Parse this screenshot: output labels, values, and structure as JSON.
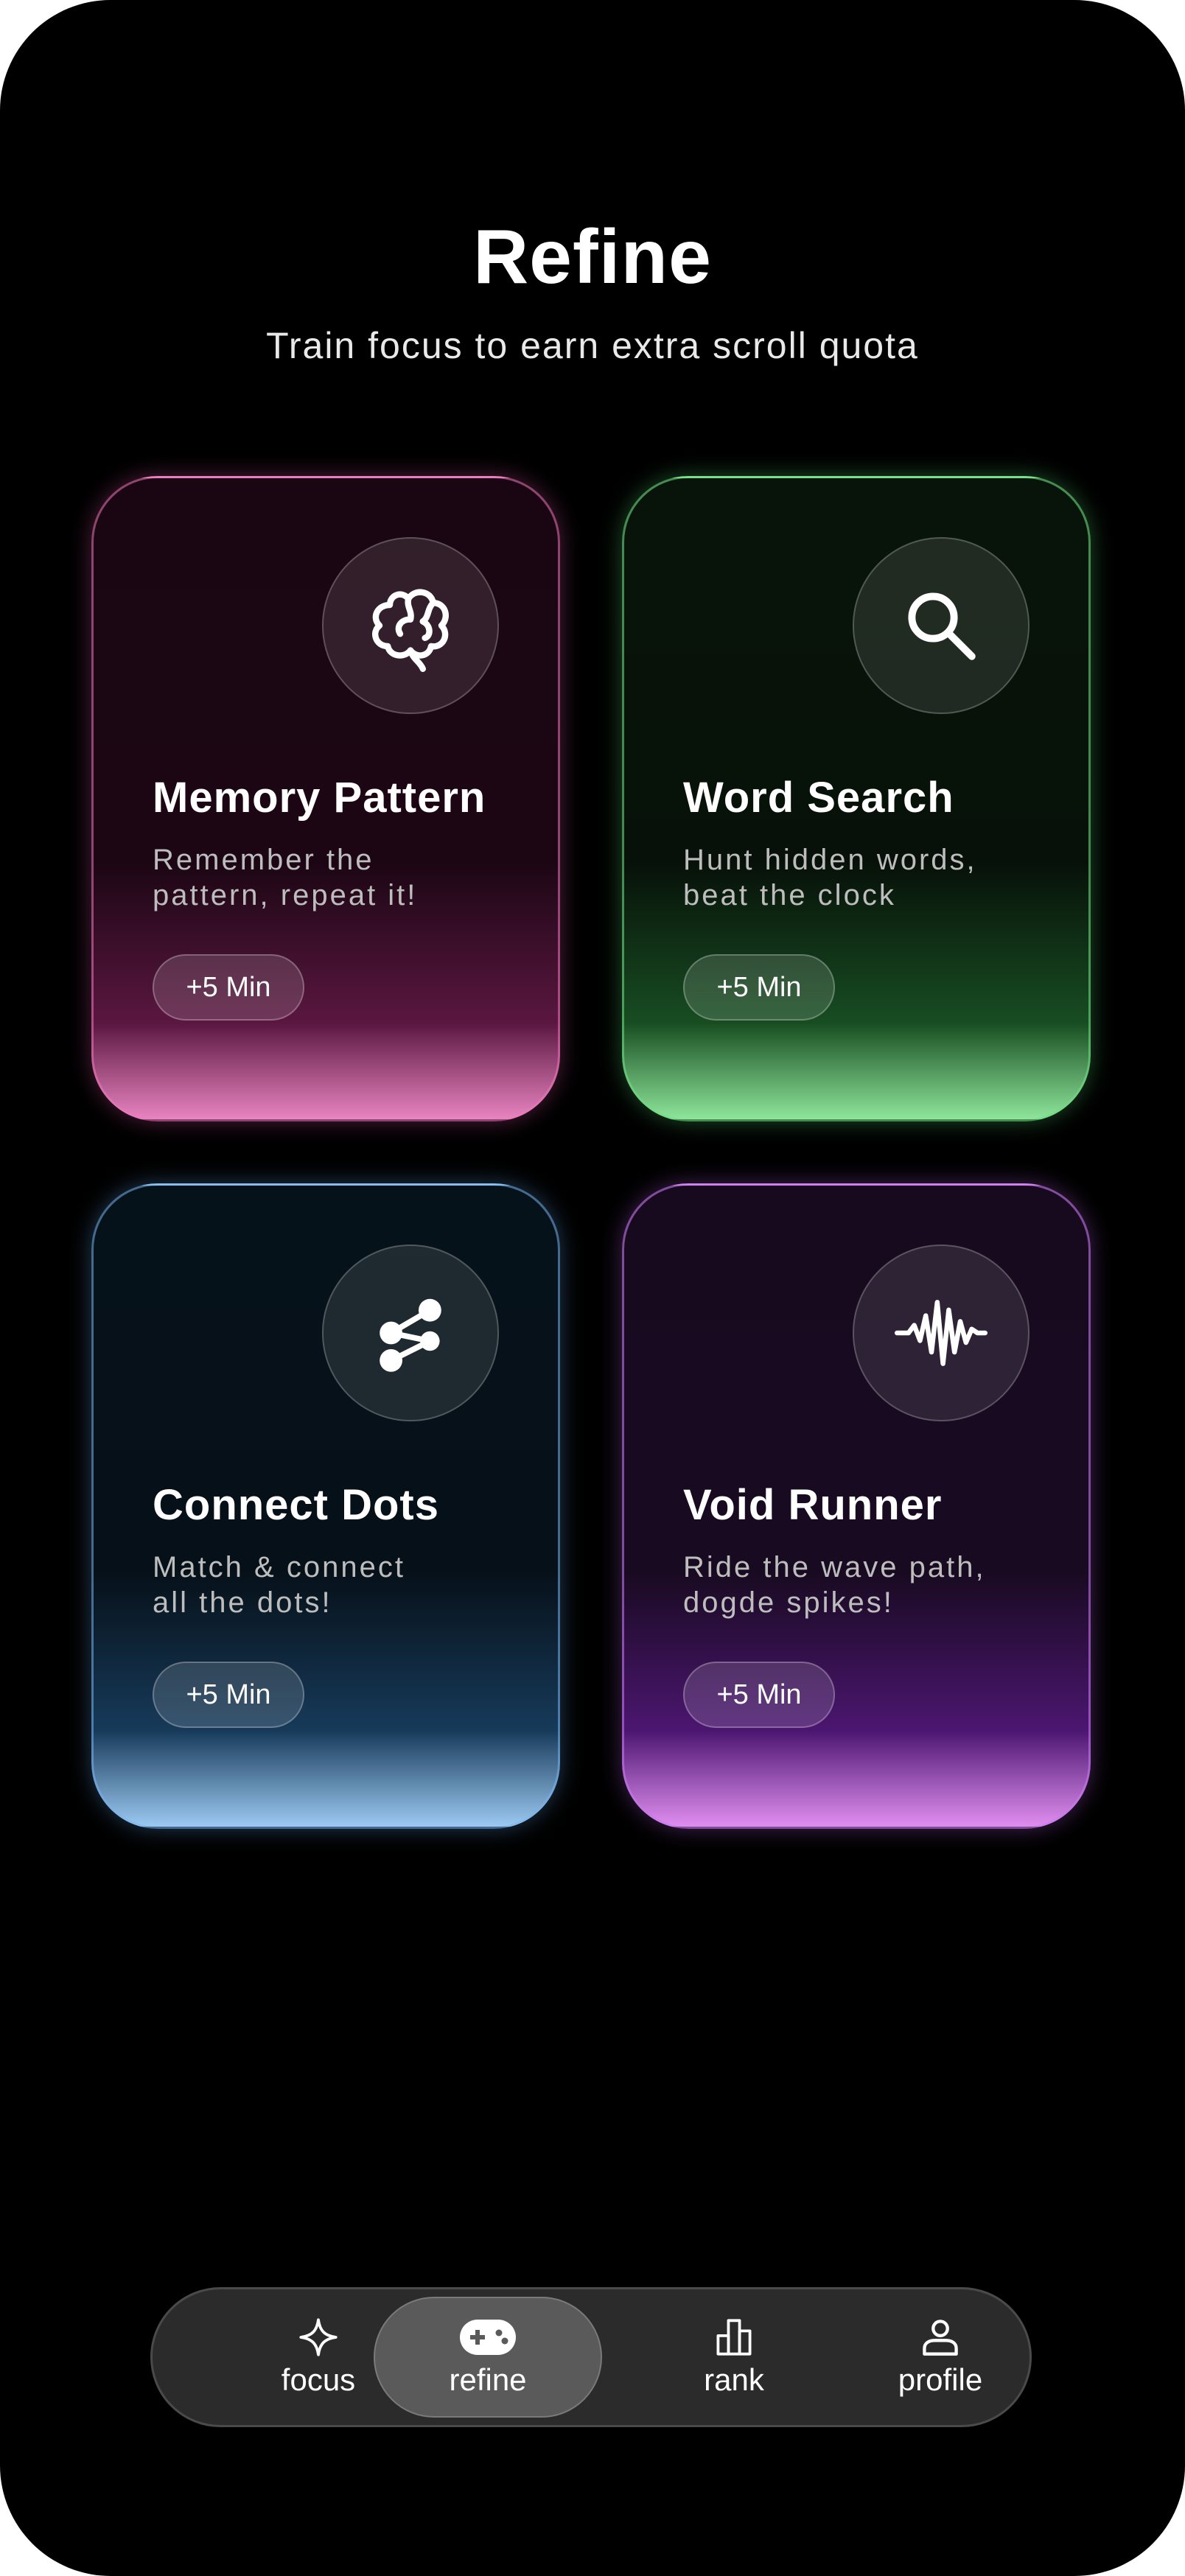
{
  "header": {
    "title": "Refine",
    "subtitle": "Train focus to earn extra scroll quota"
  },
  "cards": [
    {
      "title": "Memory Pattern",
      "desc_line1": "Remember the",
      "desc_line2": "pattern, repeat it!",
      "reward": "+5 Min",
      "icon": "brain-icon",
      "accent": "#e884c1"
    },
    {
      "title": "Word Search",
      "desc_line1": "Hunt hidden words,",
      "desc_line2": "beat the clock",
      "reward": "+5 Min",
      "icon": "search-icon",
      "accent": "#8ee59a"
    },
    {
      "title": "Connect Dots",
      "desc_line1": "Match & connect",
      "desc_line2": "all the dots!",
      "reward": "+5 Min",
      "icon": "share-nodes-icon",
      "accent": "#9cc9f2"
    },
    {
      "title": "Void Runner",
      "desc_line1": "Ride the wave path,",
      "desc_line2": "dogde spikes!",
      "reward": "+5 Min",
      "icon": "waveform-icon",
      "accent": "#e08ef0"
    }
  ],
  "nav": [
    {
      "label": "focus",
      "icon": "sparkle-icon",
      "active": false
    },
    {
      "label": "refine",
      "icon": "gamepad-icon",
      "active": true
    },
    {
      "label": "rank",
      "icon": "bar-chart-icon",
      "active": false
    },
    {
      "label": "profile",
      "icon": "user-icon",
      "active": false
    }
  ]
}
